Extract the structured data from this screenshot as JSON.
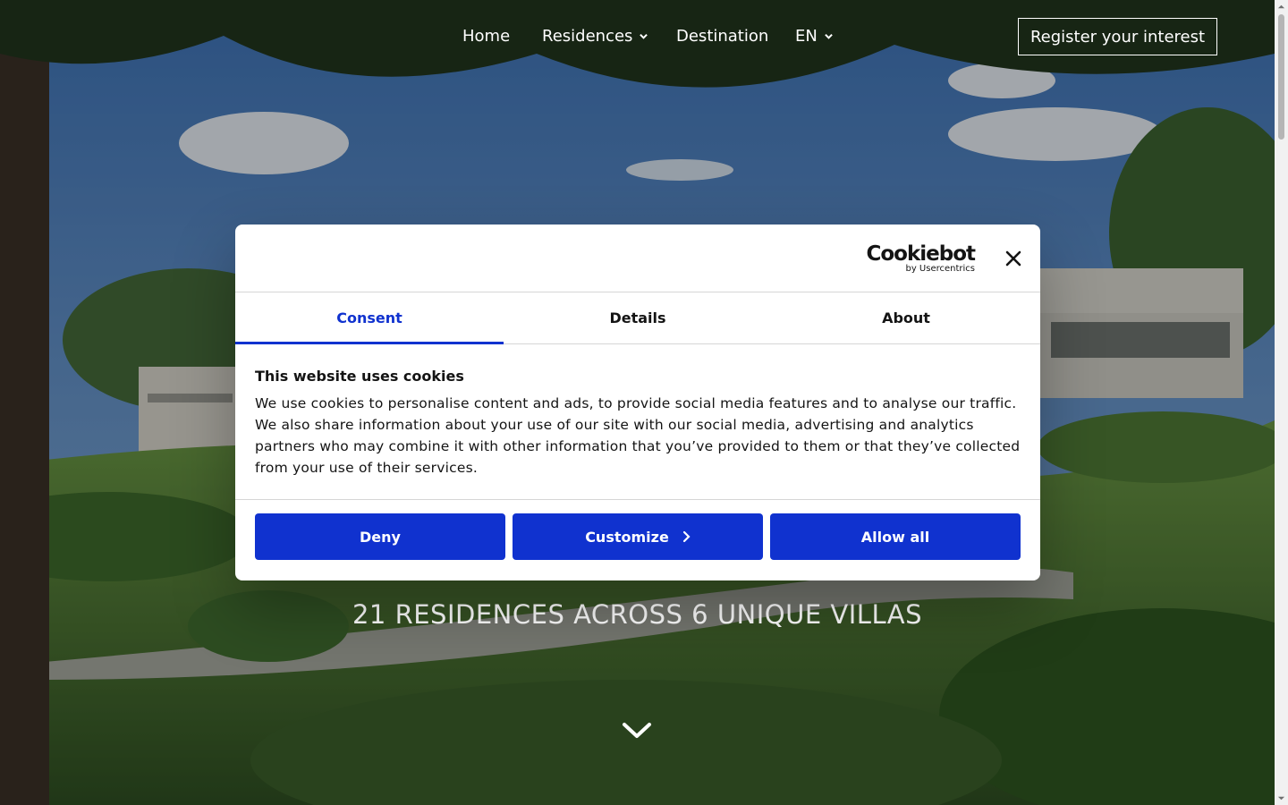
{
  "nav": {
    "items": [
      {
        "label": "Home",
        "has_dropdown": false
      },
      {
        "label": "Residences",
        "has_dropdown": true
      },
      {
        "label": "Destination",
        "has_dropdown": false
      },
      {
        "label": "EN",
        "has_dropdown": true
      }
    ],
    "cta_label": "Register your interest"
  },
  "hero": {
    "title": "21 RESIDENCES ACROSS 6 UNIQUE VILLAS",
    "scroll_icon": "chevron-down-icon"
  },
  "cookie_dialog": {
    "logo_text": "Cookiebot",
    "logo_subtext": "by Usercentrics",
    "tabs": [
      {
        "label": "Consent",
        "active": true
      },
      {
        "label": "Details",
        "active": false
      },
      {
        "label": "About",
        "active": false
      }
    ],
    "heading": "This website uses cookies",
    "body": "We use cookies to personalise content and ads, to provide social media features and to analyse our traffic. We also share information about your use of our site with our social media, advertising and analytics partners who may combine it with other information that you’ve provided to them or that they’ve collected from your use of their services.",
    "buttons": {
      "deny": "Deny",
      "customize": "Customize",
      "allow_all": "Allow all"
    },
    "accent_color": "#1032cf"
  }
}
